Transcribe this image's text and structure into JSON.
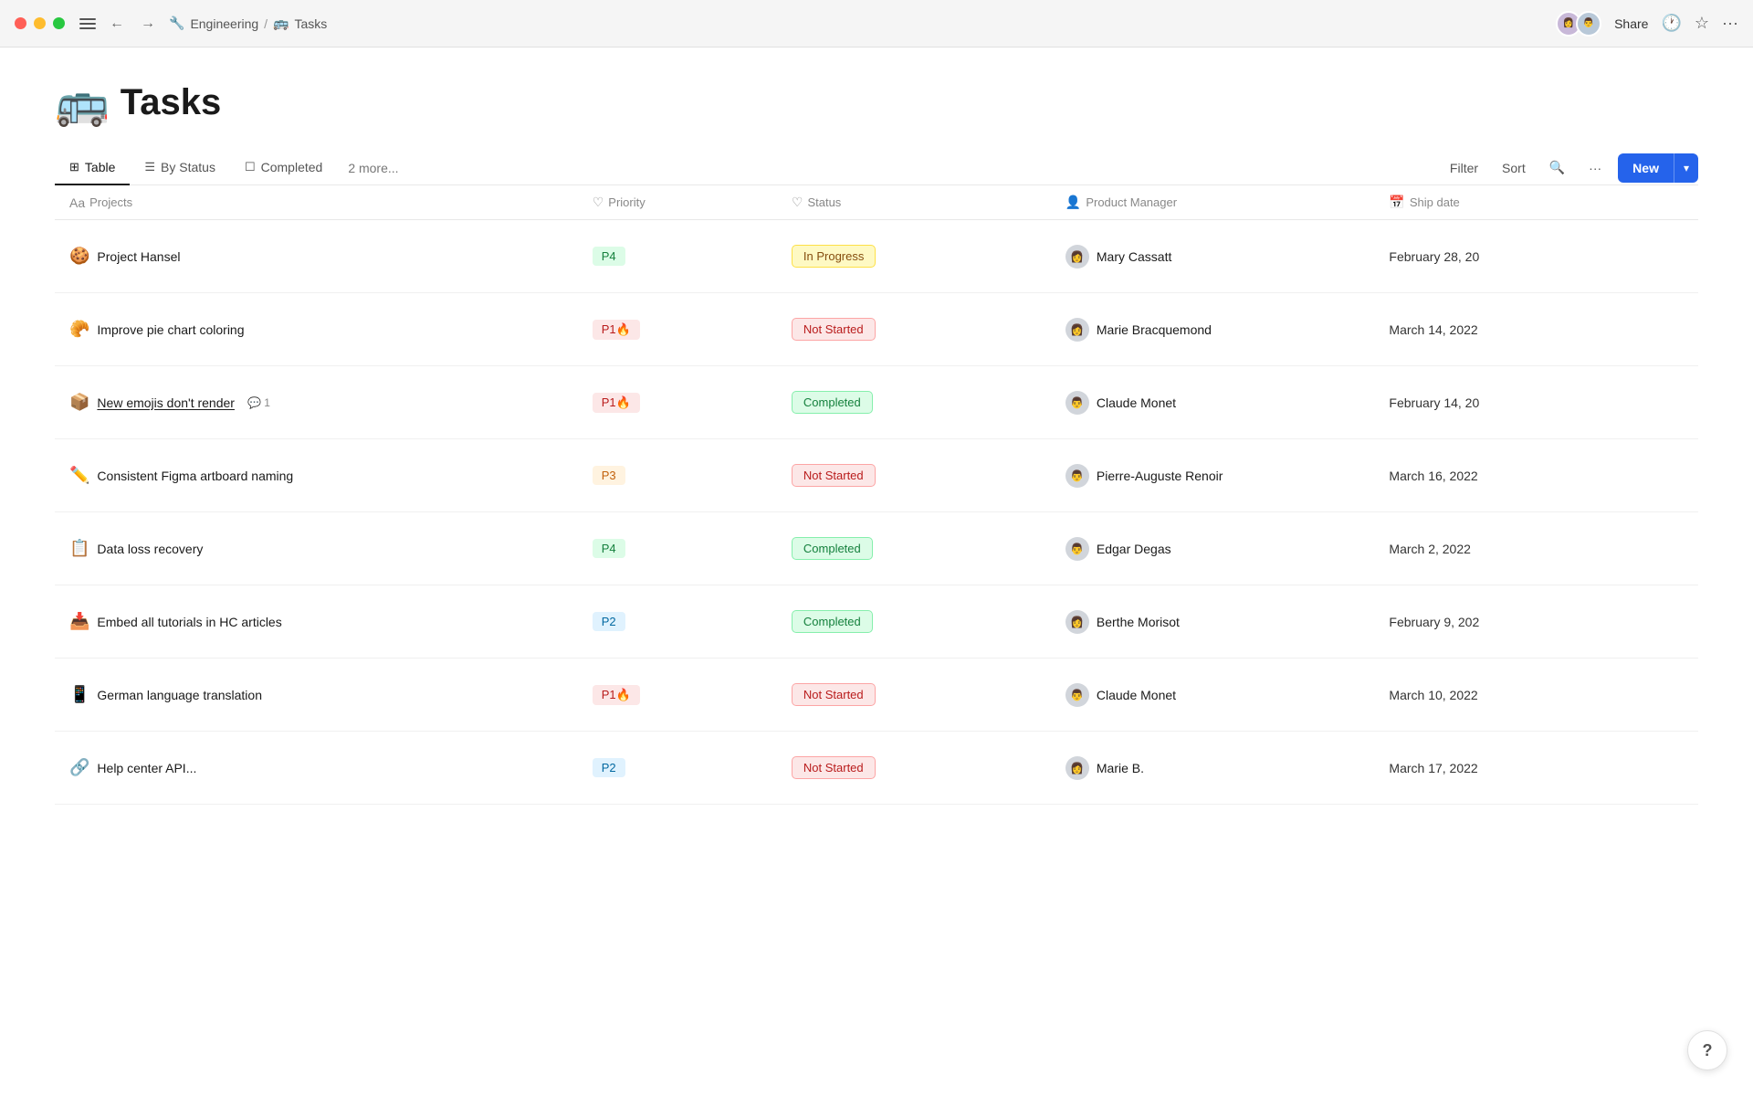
{
  "titlebar": {
    "breadcrumb_icon": "🔧",
    "breadcrumb_section": "Engineering",
    "breadcrumb_sep": "/",
    "breadcrumb_page_icon": "🚌",
    "breadcrumb_page": "Tasks",
    "share_label": "Share",
    "more_label": "···"
  },
  "page": {
    "emoji": "🚌",
    "title": "Tasks"
  },
  "tabs": [
    {
      "id": "table",
      "icon": "⊞",
      "label": "Table",
      "active": true
    },
    {
      "id": "bystatus",
      "icon": "☰",
      "label": "By Status",
      "active": false
    },
    {
      "id": "completed",
      "icon": "☐",
      "label": "Completed",
      "active": false
    }
  ],
  "more_label": "2 more...",
  "actions": {
    "filter": "Filter",
    "sort": "Sort",
    "search_icon": "🔍",
    "more_icon": "···",
    "new": "New"
  },
  "columns": [
    {
      "icon": "Aa",
      "label": "Projects"
    },
    {
      "icon": "♡",
      "label": "Priority"
    },
    {
      "icon": "♡",
      "label": "Status"
    },
    {
      "icon": "👤",
      "label": "Product Manager"
    },
    {
      "icon": "📅",
      "label": "Ship date"
    }
  ],
  "rows": [
    {
      "emoji": "🍪",
      "name": "Project Hansel",
      "underline": false,
      "comment_count": null,
      "priority": "P4",
      "priority_class": "p-green",
      "status": "In Progress",
      "status_class": "s-inprogress",
      "pm_avatar": "👩",
      "pm_name": "Mary Cassatt",
      "ship_date": "February 28, 20"
    },
    {
      "emoji": "🥐",
      "name": "Improve pie chart coloring",
      "underline": false,
      "comment_count": null,
      "priority": "P1🔥",
      "priority_class": "p-pink",
      "status": "Not Started",
      "status_class": "s-notstarted",
      "pm_avatar": "👩",
      "pm_name": "Marie Bracquemond",
      "ship_date": "March 14, 2022"
    },
    {
      "emoji": "📦",
      "name": "New emojis don't render",
      "underline": true,
      "comment_count": "1",
      "priority": "P1🔥",
      "priority_class": "p-pink",
      "status": "Completed",
      "status_class": "s-completed",
      "pm_avatar": "👨",
      "pm_name": "Claude Monet",
      "ship_date": "February 14, 20"
    },
    {
      "emoji": "✏️",
      "name": "Consistent Figma artboard naming",
      "underline": false,
      "comment_count": null,
      "priority": "P3",
      "priority_class": "p-orange",
      "status": "Not Started",
      "status_class": "s-notstarted",
      "pm_avatar": "👨",
      "pm_name": "Pierre-Auguste Renoir",
      "ship_date": "March 16, 2022"
    },
    {
      "emoji": "📋",
      "name": "Data loss recovery",
      "underline": false,
      "comment_count": null,
      "priority": "P4",
      "priority_class": "p-green",
      "status": "Completed",
      "status_class": "s-completed",
      "pm_avatar": "👨",
      "pm_name": "Edgar Degas",
      "ship_date": "March 2, 2022"
    },
    {
      "emoji": "📥",
      "name": "Embed all tutorials in HC articles",
      "underline": false,
      "comment_count": null,
      "priority": "P2",
      "priority_class": "p-blue",
      "status": "Completed",
      "status_class": "s-completed",
      "pm_avatar": "👩",
      "pm_name": "Berthe Morisot",
      "ship_date": "February 9, 202"
    },
    {
      "emoji": "📱",
      "name": "German language translation",
      "underline": false,
      "comment_count": null,
      "priority": "P1🔥",
      "priority_class": "p-pink",
      "status": "Not Started",
      "status_class": "s-notstarted",
      "pm_avatar": "👨",
      "pm_name": "Claude Monet",
      "ship_date": "March 10, 2022"
    },
    {
      "emoji": "🔗",
      "name": "Help center API...",
      "underline": false,
      "comment_count": null,
      "priority": "P2",
      "priority_class": "p-blue",
      "status": "Not Started",
      "status_class": "s-notstarted",
      "pm_avatar": "👩",
      "pm_name": "Marie B.",
      "ship_date": "March 17, 2022"
    }
  ],
  "help_label": "?"
}
